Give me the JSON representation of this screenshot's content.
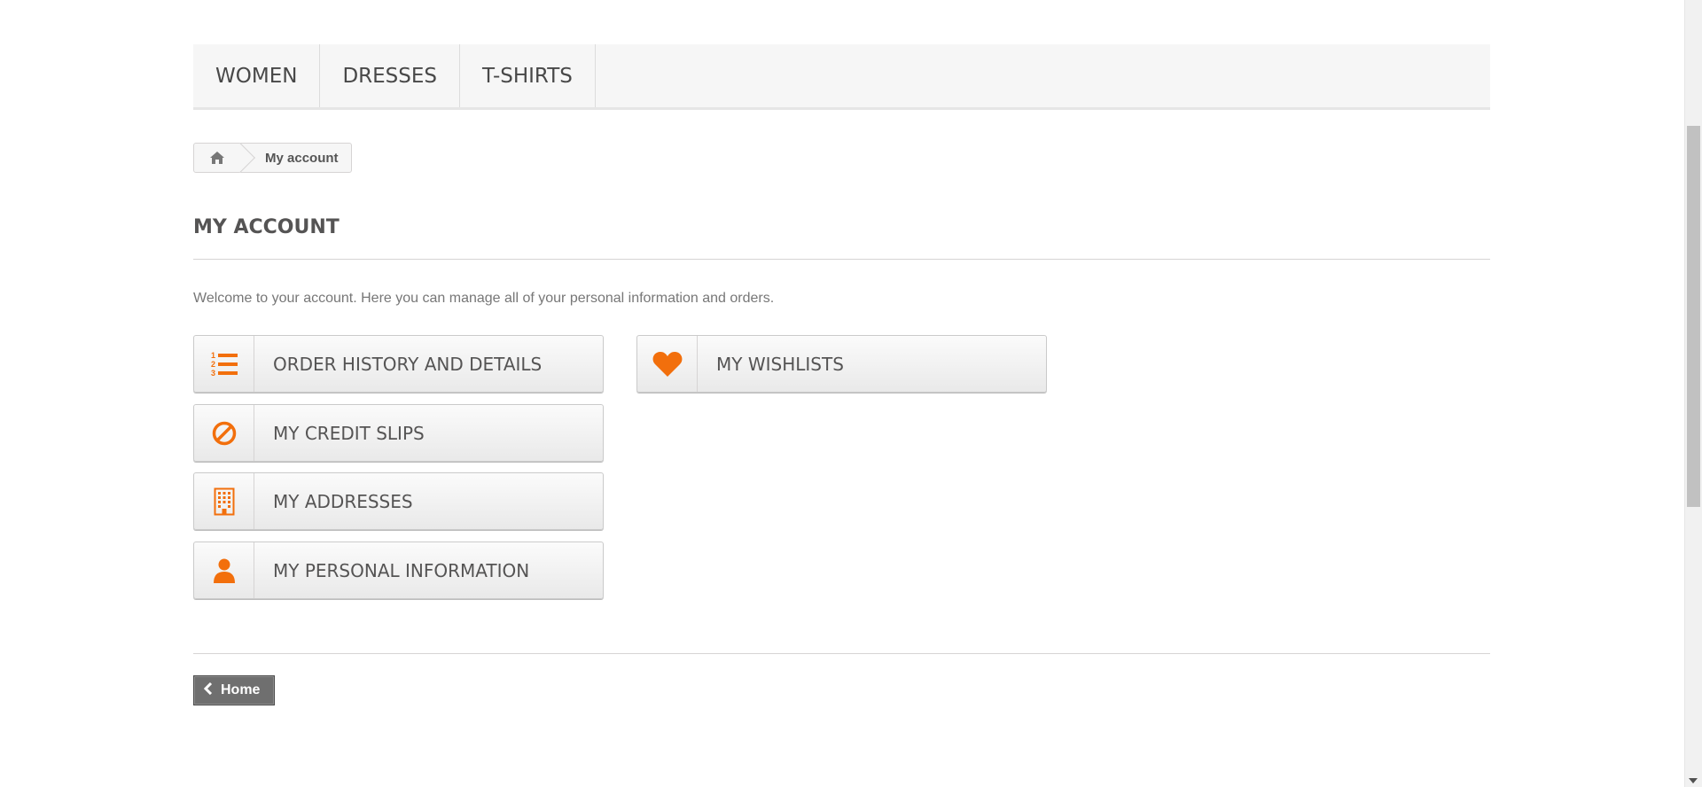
{
  "menu": {
    "items": [
      {
        "label": "WOMEN"
      },
      {
        "label": "DRESSES"
      },
      {
        "label": "T-SHIRTS"
      }
    ]
  },
  "breadcrumb": {
    "home_icon": "home-icon",
    "current": "My account"
  },
  "page": {
    "title": "MY ACCOUNT",
    "welcome": "Welcome to your account. Here you can manage all of your personal information and orders."
  },
  "account_links": {
    "order_history": {
      "label": "ORDER HISTORY AND DETAILS",
      "icon": "ordered-list-icon"
    },
    "credit_slips": {
      "label": "MY CREDIT SLIPS",
      "icon": "ban-icon"
    },
    "addresses": {
      "label": "MY ADDRESSES",
      "icon": "building-icon"
    },
    "personal_info": {
      "label": "MY PERSONAL INFORMATION",
      "icon": "user-icon"
    },
    "wishlists": {
      "label": "MY WISHLISTS",
      "icon": "heart-icon"
    }
  },
  "footer": {
    "home_button": "Home"
  },
  "colors": {
    "accent": "#f26f0c",
    "menu_bg": "#f6f6f6",
    "home_button_bg": "#6f6f6f"
  }
}
